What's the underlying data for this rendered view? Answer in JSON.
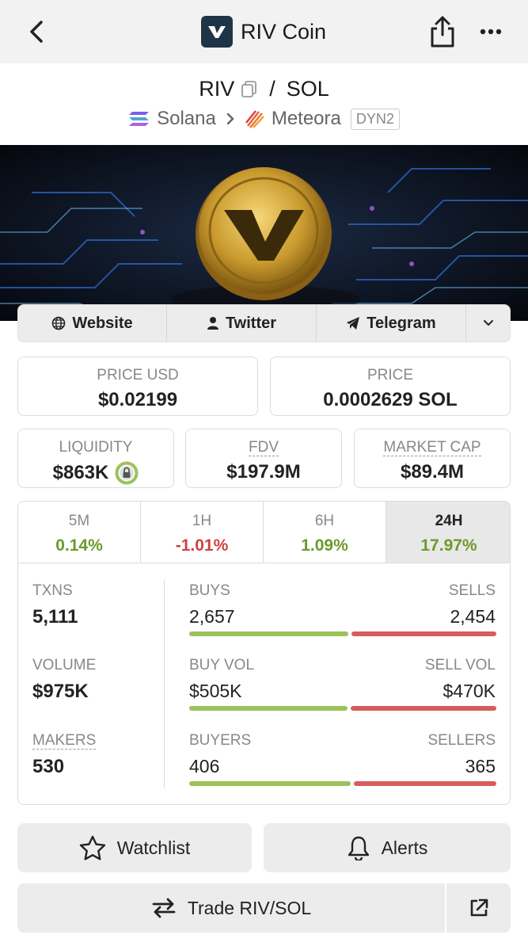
{
  "header": {
    "title": "RIV Coin",
    "back_icon": "chevron-left-icon",
    "share_icon": "share-icon",
    "more_icon": "more-horizontal-icon"
  },
  "pair": {
    "base": "RIV",
    "separator": "/",
    "quote": "SOL",
    "chain": "Solana",
    "dex": "Meteora",
    "dex_badge": "DYN2"
  },
  "links": {
    "website": "Website",
    "twitter": "Twitter",
    "telegram": "Telegram"
  },
  "price_cards": {
    "price_usd_label": "PRICE USD",
    "price_usd": "$0.02199",
    "price_label": "PRICE",
    "price": "0.0002629 SOL",
    "liquidity_label": "LIQUIDITY",
    "liquidity": "$863K",
    "fdv_label": "FDV",
    "fdv": "$197.9M",
    "mcap_label": "MARKET CAP",
    "mcap": "$89.4M"
  },
  "timeframes": [
    {
      "label": "5M",
      "change": "0.14%"
    },
    {
      "label": "1H",
      "change": "-1.01%"
    },
    {
      "label": "6H",
      "change": "1.09%"
    },
    {
      "label": "24H",
      "change": "17.97%"
    }
  ],
  "stats": {
    "txns_label": "TXNS",
    "txns": "5,111",
    "volume_label": "VOLUME",
    "volume": "$975K",
    "makers_label": "MAKERS",
    "makers": "530",
    "buys_label": "BUYS",
    "buys": "2,657",
    "sells_label": "SELLS",
    "sells": "2,454",
    "buy_vol_label": "BUY VOL",
    "buy_vol": "$505K",
    "sell_vol_label": "SELL VOL",
    "sell_vol": "$470K",
    "buyers_label": "BUYERS",
    "buyers": "406",
    "sellers_label": "SELLERS",
    "sellers": "365",
    "buy_color": "#9cc25a",
    "sell_color": "#d95c5c"
  },
  "actions": {
    "watchlist": "Watchlist",
    "alerts": "Alerts",
    "trade": "Trade RIV/SOL"
  }
}
